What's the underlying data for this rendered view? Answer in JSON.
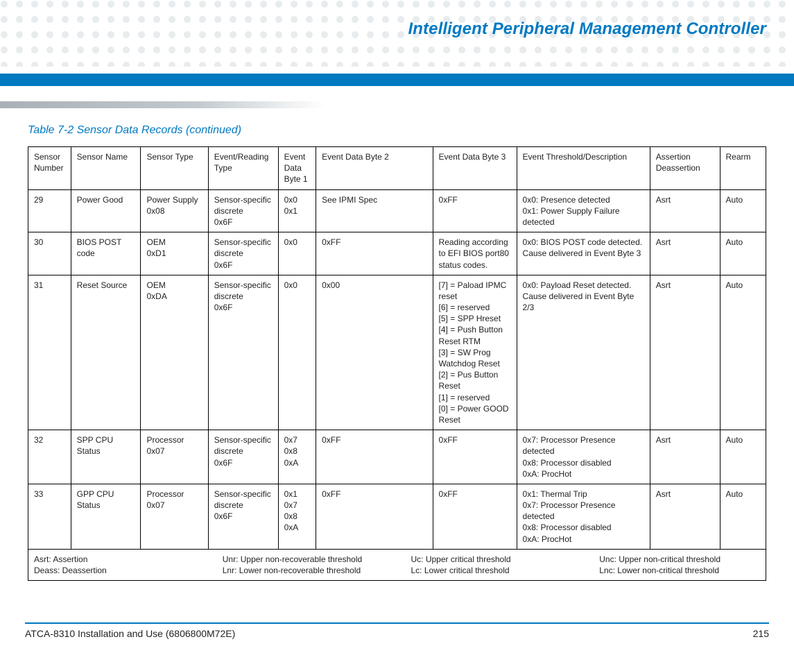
{
  "header": {
    "chapter_title": "Intelligent Peripheral Management Controller"
  },
  "table": {
    "caption": "Table 7-2 Sensor Data Records (continued)",
    "headers": {
      "sensor_number": "Sensor Number",
      "sensor_name": "Sensor Name",
      "sensor_type": "Sensor Type",
      "event_reading_type": "Event/Reading Type",
      "event_data_byte1": "Event Data Byte 1",
      "event_data_byte2": "Event Data Byte 2",
      "event_data_byte3": "Event Data Byte 3",
      "threshold_desc": "Event Threshold/Description",
      "assertion": "Assertion Deassertion",
      "rearm": "Rearm"
    },
    "rows": [
      {
        "num": "29",
        "name": "Power Good",
        "type": "Power Supply 0x08",
        "evt": "Sensor-specific discrete\n0x6F",
        "b1": "0x0\n0x1",
        "b2": "See IPMI Spec",
        "b3": "0xFF",
        "desc": "0x0: Presence detected\n0x1: Power Supply Failure detected",
        "ass": "Asrt",
        "rearm": "Auto"
      },
      {
        "num": "30",
        "name": "BIOS POST code",
        "type": "OEM\n0xD1",
        "evt": "Sensor-specific discrete\n0x6F",
        "b1": "0x0",
        "b2": "0xFF",
        "b3": "Reading according to EFI BIOS port80 status codes.",
        "desc": "0x0: BIOS POST code detected. Cause delivered in Event Byte 3",
        "ass": "Asrt",
        "rearm": "Auto"
      },
      {
        "num": "31",
        "name": "Reset Source",
        "type": "OEM\n0xDA",
        "evt": "Sensor-specific discrete\n0x6F",
        "b1": "0x0",
        "b2": "0x00",
        "b3": "[7] = Paload IPMC reset\n[6] = reserved\n[5] = SPP Hreset\n[4] = Push Button Reset RTM\n[3] = SW Prog Watchdog Reset\n[2] = Pus Button Reset\n[1] = reserved\n[0] = Power GOOD Reset",
        "desc": "0x0: Payload Reset detected. Cause delivered in Event Byte 2/3",
        "ass": "Asrt",
        "rearm": "Auto"
      },
      {
        "num": "32",
        "name": "SPP CPU Status",
        "type": "Processor\n0x07",
        "evt": "Sensor-specific discrete\n0x6F",
        "b1": "0x7\n0x8\n0xA",
        "b2": "0xFF",
        "b3": "0xFF",
        "desc": "0x7: Processor Presence detected\n0x8: Processor disabled\n0xA: ProcHot",
        "ass": "Asrt",
        "rearm": "Auto"
      },
      {
        "num": "33",
        "name": "GPP CPU Status",
        "type": "Processor\n0x07",
        "evt": "Sensor-specific discrete\n0x6F",
        "b1": "0x1\n0x7\n0x8\n0xA",
        "b2": "0xFF",
        "b3": "0xFF",
        "desc": "0x1: Thermal Trip\n0x7: Processor Presence detected\n0x8: Processor disabled\n0xA: ProcHot",
        "ass": "Asrt",
        "rearm": "Auto"
      }
    ],
    "legend": {
      "c1a": "Asrt: Assertion",
      "c1b": "Deass: Deassertion",
      "c2a": "Unr: Upper non-recoverable threshold",
      "c2b": "Lnr: Lower non-recoverable threshold",
      "c3a": "Uc: Upper critical threshold",
      "c3b": "Lc: Lower critical threshold",
      "c4a": "Unc: Upper non-critical threshold",
      "c4b": "Lnc: Lower non-critical threshold"
    }
  },
  "footer": {
    "doc": "ATCA-8310 Installation and Use (6806800M72E)",
    "page": "215"
  }
}
